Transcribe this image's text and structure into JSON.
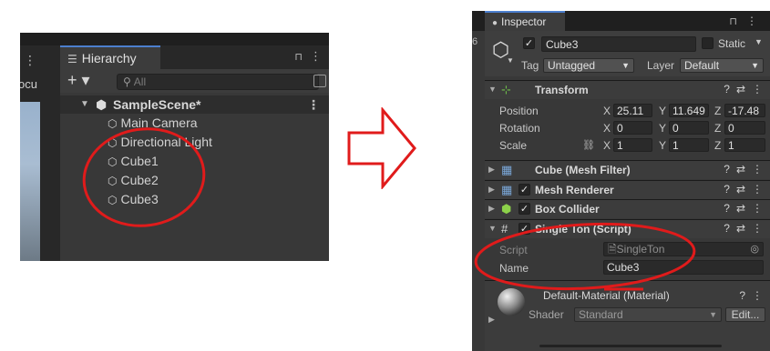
{
  "hierarchy": {
    "edge_text": "ocu",
    "tab_title": "Hierarchy",
    "lock_glyph": "🔒",
    "menu_glyph": "⋮",
    "add_glyph": "+ ▾",
    "search_placeholder": "All",
    "scene_name": "SampleScene*",
    "items": [
      "Main Camera",
      "Directional Light",
      "Cube1",
      "Cube2",
      "Cube3"
    ]
  },
  "inspector": {
    "edge_digit": "6",
    "tab_title": "Inspector",
    "object_name": "Cube3",
    "static_label": "Static",
    "tag_label": "Tag",
    "tag_value": "Untagged",
    "layer_label": "Layer",
    "layer_value": "Default",
    "components": {
      "transform": "Transform",
      "mesh_filter": "Cube (Mesh Filter)",
      "mesh_renderer": "Mesh Renderer",
      "box_collider": "Box Collider",
      "single_ton": "Single Ton (Script)"
    },
    "transform": {
      "position_label": "Position",
      "rotation_label": "Rotation",
      "scale_label": "Scale",
      "axis_x": "X",
      "axis_y": "Y",
      "axis_z": "Z",
      "position": {
        "x": "25.11",
        "y": "11.649",
        "z": "-17.48"
      },
      "rotation": {
        "x": "0",
        "y": "0",
        "z": "0"
      },
      "scale": {
        "x": "1",
        "y": "1",
        "z": "1"
      }
    },
    "script": {
      "script_label": "Script",
      "script_value": "SingleTon",
      "name_label": "Name",
      "name_value": "Cube3"
    },
    "material": {
      "title": "Default-Material (Material)",
      "shader_label": "Shader",
      "shader_value": "Standard",
      "edit_label": "Edit..."
    },
    "tools": {
      "help": "?",
      "settings": "⇄",
      "menu": "⋮"
    }
  },
  "colors": {
    "annotation_red": "#e01b1b",
    "panel_dark": "#383838",
    "tab_accent": "#4c7fce"
  }
}
